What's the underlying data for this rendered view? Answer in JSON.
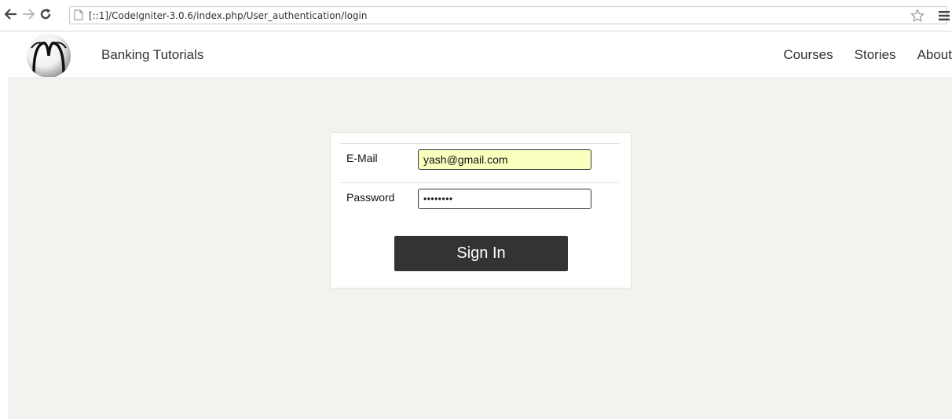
{
  "browser": {
    "url": "[::1]/CodeIgniter-3.0.6/index.php/User_authentication/login",
    "icons": [
      "back-arrow-icon",
      "forward-arrow-icon",
      "reload-icon",
      "page-icon",
      "star-icon",
      "menu-icon"
    ]
  },
  "header": {
    "brand": "Banking Tutorials",
    "nav": [
      "Courses",
      "Stories",
      "About"
    ]
  },
  "form": {
    "email_label": "E-Mail",
    "email_value": "yash@gmail.com",
    "password_label": "Password",
    "password_value": "••••••••",
    "submit_label": "Sign In"
  },
  "colors": {
    "page_background": "#f2f2ee",
    "button_background": "#333333",
    "autofill_background": "#fbffbe"
  }
}
